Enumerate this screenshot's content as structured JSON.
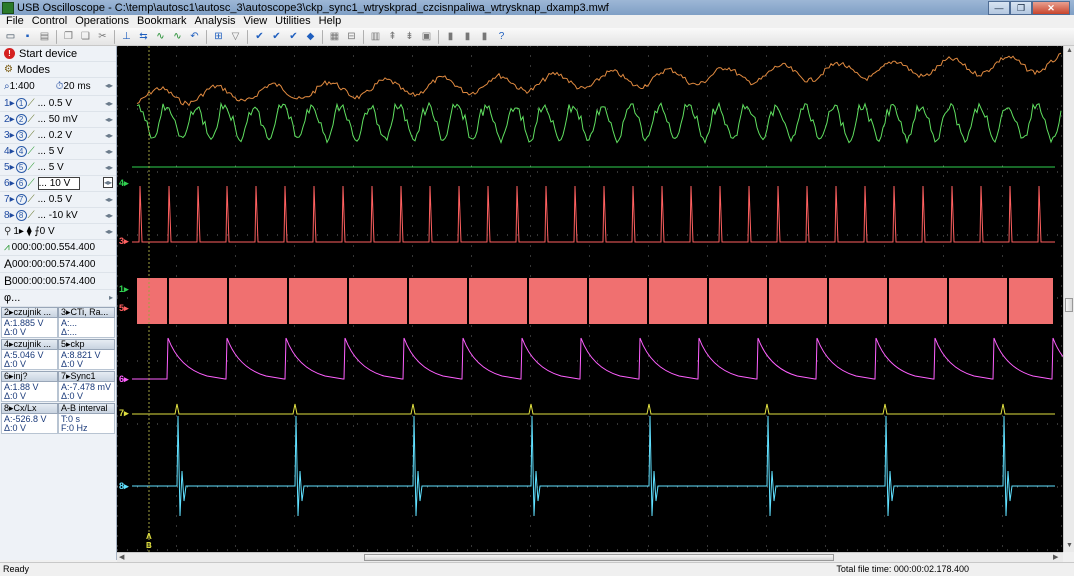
{
  "window": {
    "title": "USB Oscilloscope - C:\\temp\\autosc1\\autosc_3\\autoscope3\\ckp_sync1_wtryskprad_czcisnpaliwa_wtrysknap_dxamp3.mwf",
    "minimize": "—",
    "restore": "❐",
    "close": "✕"
  },
  "menu": [
    "File",
    "Control",
    "Operations",
    "Bookmark",
    "Analysis",
    "View",
    "Utilities",
    "Help"
  ],
  "sidebar": {
    "start_device": "Start device",
    "modes": "Modes",
    "zoom": "1:400",
    "timebase": "20 ms",
    "channels": [
      {
        "num": "1",
        "label": "... 0.5 V"
      },
      {
        "num": "2",
        "label": "... 50 mV"
      },
      {
        "num": "3",
        "label": "... 0.2 V"
      },
      {
        "num": "4",
        "label": "... 5 V"
      },
      {
        "num": "5",
        "label": "... 5 V"
      },
      {
        "num": "6",
        "label": "... 10 V"
      },
      {
        "num": "7",
        "label": "... 0.5 V"
      },
      {
        "num": "8",
        "label": "... -10 kV"
      }
    ],
    "trigger": "1▸ ⧫ ⨍0 V",
    "trigger_time": "000:00:00.554.400",
    "cursor_a": "000:00:00.574.400",
    "cursor_b": "000:00:00.574.400",
    "phi": "φ..."
  },
  "info_panel": [
    {
      "head": "2▸czujnik ...",
      "line1": "A:1.885 V",
      "line2": "Δ:0 V"
    },
    {
      "head": "3▸CTi, Ra...",
      "line1": "A:...",
      "line2": "Δ:..."
    },
    {
      "head": "4▸czujnik ...",
      "line1": "A:5.046 V",
      "line2": "Δ:0 V"
    },
    {
      "head": "5▸ckp",
      "line1": "A:8.821 V",
      "line2": "Δ:0 V"
    },
    {
      "head": "6▸inj?",
      "line1": "A:1.88 V",
      "line2": "Δ:0 V"
    },
    {
      "head": "7▸Sync1",
      "line1": "A:-7.478 mV",
      "line2": "Δ:0 V"
    },
    {
      "head": "8▸Cx/Lx",
      "line1": "A:-526.8 V",
      "line2": "Δ:0 V"
    },
    {
      "head": "A-B interval",
      "line1": "T:0 s",
      "line2": "F:0 Hz"
    }
  ],
  "channel_markers": [
    {
      "label": "4▸",
      "color": "#30d050"
    },
    {
      "label": "3▸",
      "color": "#ff6060"
    },
    {
      "label": "1▸",
      "color": "#30d050"
    },
    {
      "label": "5▸",
      "color": "#ff6060"
    },
    {
      "label": "6▸",
      "color": "#ff60ff"
    },
    {
      "label": "7▸",
      "color": "#e0e040"
    },
    {
      "label": "8▸",
      "color": "#60e0ff"
    }
  ],
  "cursor_labels": {
    "a": "A",
    "b": "B"
  },
  "status": {
    "left": "Ready",
    "right": "Total file time: 000:00:02.178.400"
  }
}
